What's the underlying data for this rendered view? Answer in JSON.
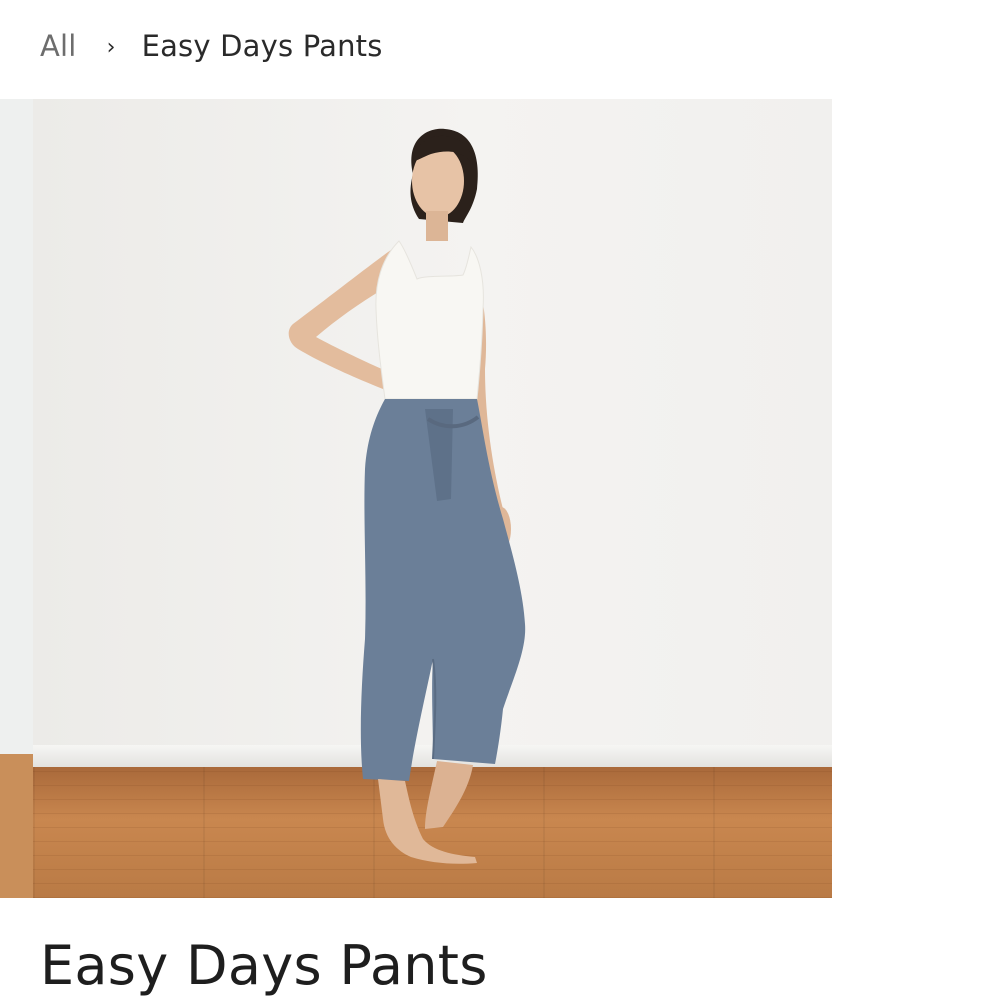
{
  "breadcrumb": {
    "root_label": "All",
    "separator": "›",
    "current_label": "Easy Days Pants"
  },
  "product": {
    "title": "Easy Days Pants",
    "image_alt": "Model wearing Easy Days Pants in slate blue with white tank top"
  },
  "colors": {
    "pants": "#6b7f98",
    "floor": "#c0824c",
    "wall": "#f0efed"
  }
}
